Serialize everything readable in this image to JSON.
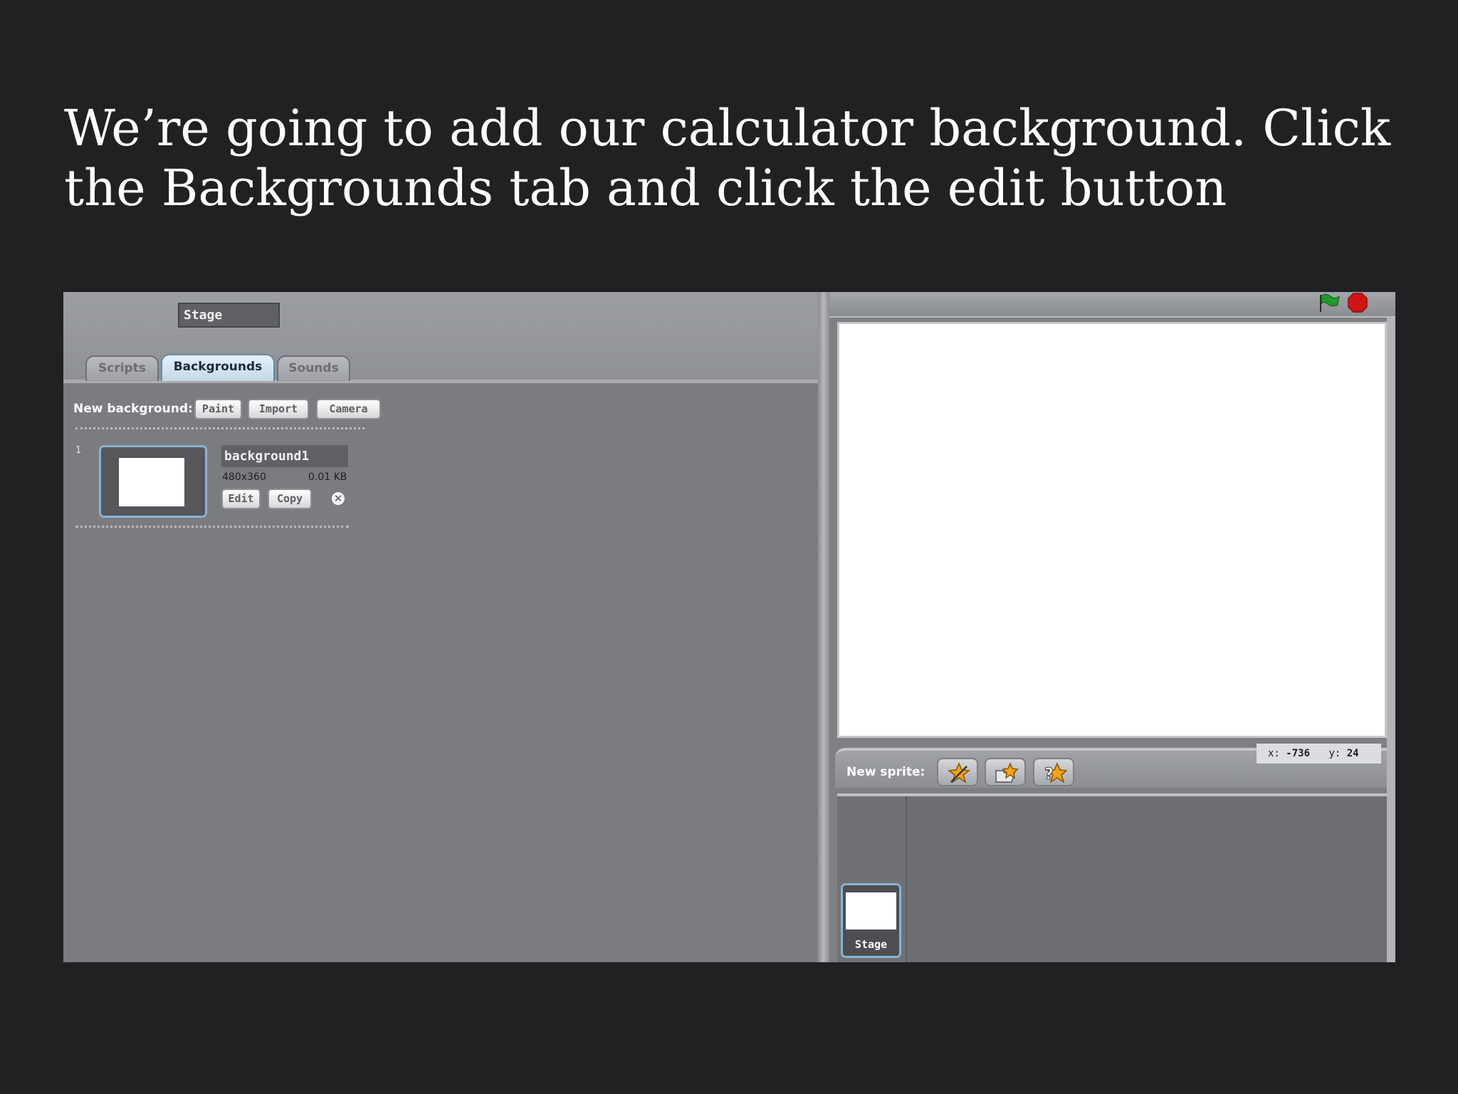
{
  "slide": {
    "title_line1": "We’re going to add our calculator background. Click",
    "title_line2": "the Backgrounds tab and click the edit button"
  },
  "left_panel": {
    "object_name": "Stage",
    "tabs": [
      {
        "label": "Scripts",
        "active": false
      },
      {
        "label": "Backgrounds",
        "active": true
      },
      {
        "label": "Sounds",
        "active": false
      }
    ],
    "new_background_label": "New background:",
    "buttons": {
      "paint": "Paint",
      "import": "Import",
      "camera": "Camera"
    },
    "costumes": [
      {
        "number": "1",
        "name": "background1",
        "dimensions": "480x360",
        "size": "0.01 KB",
        "edit": "Edit",
        "copy": "Copy"
      }
    ],
    "delete_icon": "close-circle-icon"
  },
  "right_panel": {
    "icons": {
      "green_flag": "green-flag-icon",
      "stop": "stop-sign-icon"
    },
    "colors": {
      "flag": "#1e9a2a",
      "stop": "#d21414",
      "selected_border": "#8ab2d4"
    },
    "coords": {
      "x_label": "x:",
      "x_value": "-736",
      "y_label": "y:",
      "y_value": "24"
    },
    "new_sprite_label": "New sprite:",
    "sprite_buttons": [
      "paint-new-sprite-icon",
      "choose-sprite-file-icon",
      "random-sprite-icon"
    ],
    "stage_thumbnail_label": "Stage"
  }
}
